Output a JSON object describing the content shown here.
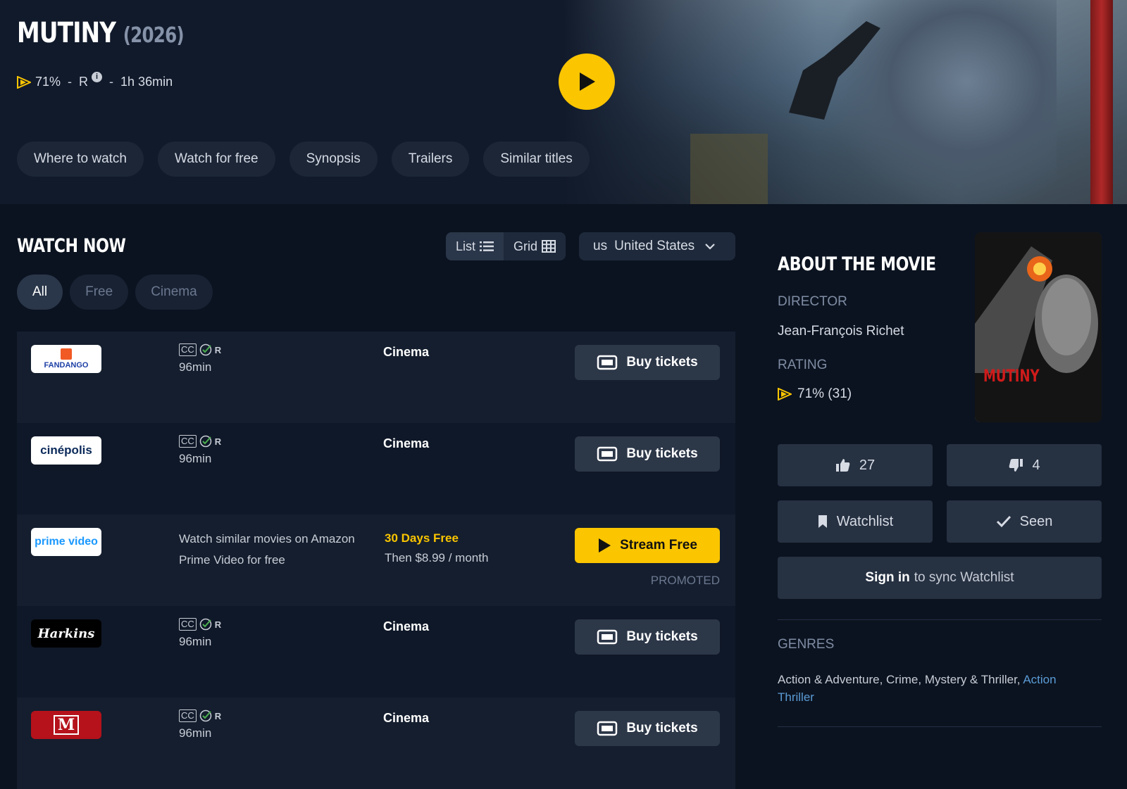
{
  "movie": {
    "title": "MUTINY",
    "year": "(2026)",
    "score": "71%",
    "rating": "R",
    "info_glyph": "i",
    "runtime": "1h 36min",
    "separator": "-"
  },
  "hero_tabs": [
    "Where to watch",
    "Watch for free",
    "Synopsis",
    "Trailers",
    "Similar titles"
  ],
  "watch_now": {
    "heading": "WATCH NOW",
    "view_list": "List",
    "view_grid": "Grid",
    "country_code": "us",
    "country_name": "United States",
    "filters": [
      "All",
      "Free",
      "Cinema"
    ]
  },
  "offers": [
    {
      "logo": "FANDANGO",
      "cc": "CC",
      "rating": "R",
      "duration": "96min",
      "type": "Cinema",
      "button": "Buy tickets"
    },
    {
      "logo": "cinépolis",
      "cc": "CC",
      "rating": "R",
      "duration": "96min",
      "type": "Cinema",
      "button": "Buy tickets"
    },
    {
      "logo": "prime video",
      "text": "Watch similar movies on Amazon Prime Video for free",
      "highlight": "30 Days Free",
      "price": "Then $8.99 / month",
      "button": "Stream Free",
      "promoted": "PROMOTED"
    },
    {
      "logo": "Harkins",
      "cc": "CC",
      "rating": "R",
      "duration": "96min",
      "type": "Cinema",
      "button": "Buy tickets"
    },
    {
      "logo": "M",
      "cc": "CC",
      "rating": "R",
      "duration": "96min",
      "type": "Cinema",
      "button": "Buy tickets"
    }
  ],
  "about": {
    "heading": "ABOUT THE MOVIE",
    "director_label": "DIRECTOR",
    "director": "Jean-François Richet",
    "rating_label": "RATING",
    "rating_value": "71% (31)",
    "poster_title": "MUTINY",
    "likes": "27",
    "dislikes": "4",
    "watchlist": "Watchlist",
    "seen": "Seen",
    "signin_bold": "Sign in",
    "signin_rest": "to sync Watchlist",
    "genres_label": "GENRES",
    "genres_text": "Action & Adventure, Crime, Mystery & Thriller,",
    "genres_link": "Action Thriller"
  },
  "colors": {
    "accent": "#fbc500",
    "background": "#0b1320",
    "link": "#5b9bd5"
  }
}
